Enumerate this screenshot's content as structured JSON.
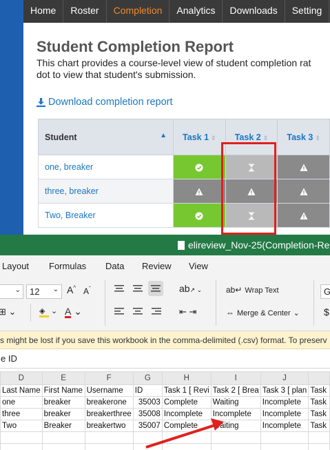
{
  "nav": {
    "items": [
      "Home",
      "Roster",
      "Completion",
      "Analytics",
      "Downloads",
      "Setting"
    ],
    "active_index": 2
  },
  "report": {
    "title": "Student Completion Report",
    "desc_line1": "This chart provides a course-level view of student completion rat",
    "desc_line2": "dot to view that student's submission.",
    "download_label": "Download completion report",
    "columns": [
      "Student",
      "Task 1",
      "Task 2",
      "Task 3"
    ],
    "rows": [
      {
        "name": "one, breaker",
        "tasks": [
          "complete",
          "waiting",
          "incomplete"
        ]
      },
      {
        "name": "three, breaker",
        "tasks": [
          "incomplete",
          "incomplete",
          "incomplete"
        ]
      },
      {
        "name": "Two, Breaker",
        "tasks": [
          "complete",
          "waiting",
          "incomplete"
        ]
      }
    ]
  },
  "excel": {
    "filename": "elireview_Nov-25(Completion-Rep",
    "tabs": [
      "Layout",
      "Formulas",
      "Data",
      "Review",
      "View"
    ],
    "font_size": "12",
    "wrap_text_label": "Wrap Text",
    "merge_label": "Merge & Center",
    "general_label": "G",
    "message": "s might be lost if you save this workbook in the comma-delimited (.csv) format. To preserv",
    "formula_bar": "e ID",
    "col_letters": [
      "D",
      "E",
      "F",
      "G",
      "H",
      "I",
      "J",
      ""
    ],
    "header_row": [
      "Last Name",
      "First Name",
      "Username",
      "ID",
      "Task 1 [ Revi",
      "Task 2 [ Brea",
      "Task 3 [ plan",
      "Task"
    ],
    "rows": [
      [
        "one",
        "breaker",
        "breakerone",
        "35003",
        "Complete",
        "Waiting",
        "Incomplete",
        "Task"
      ],
      [
        "three",
        "breaker",
        "breakerthree",
        "35008",
        "Incomplete",
        "Incomplete",
        "Incomplete",
        "Task"
      ],
      [
        "Two",
        "Breaker",
        "breakertwo",
        "35007",
        "Complete",
        "Waiting",
        "Incomplete",
        "Task"
      ]
    ]
  },
  "colors": {
    "complete": "#77c830",
    "incomplete": "#8a8a8a",
    "waiting": "#b9b9b9",
    "excel_green": "#237a45",
    "highlight_red": "#e02020"
  }
}
